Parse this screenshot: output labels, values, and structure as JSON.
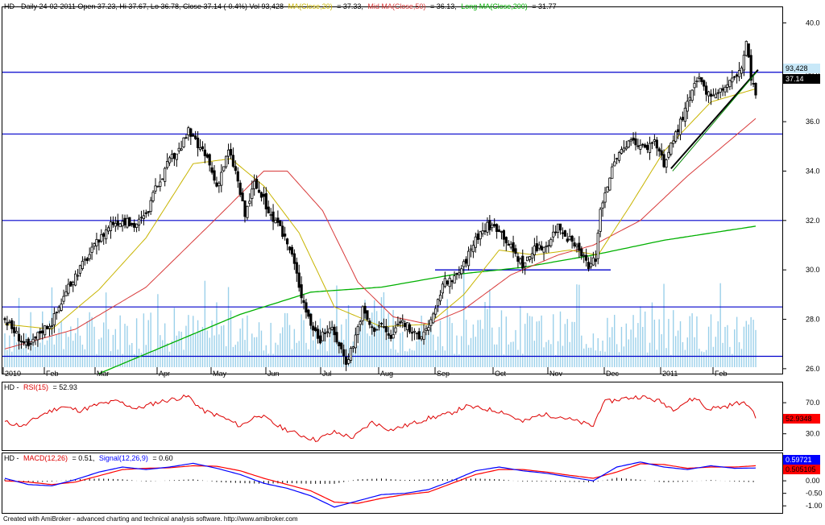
{
  "colors": {
    "price": "#000000",
    "ma20": "#c8b400",
    "ma50": "#d83a3a",
    "ma200": "#00b000",
    "volume": "#9bd0ea",
    "hline": "#0000cc",
    "trend": "#000000",
    "trend_green": "#008800",
    "rsi": "#dd0000",
    "macd": "#0000ff",
    "signal": "#ff0000",
    "hist": "#000000"
  },
  "header": {
    "symbol_info": "HD - Daily 24-02-2011 Open 37.23, Hi 37.67, Lo 36.78, Close 37.14 (-0.4%) Vol 93,428",
    "ma20_label": "MA(Close,20)",
    "ma20_value": "= 37.33,",
    "ma50_label": "Mid MA(Close,50)",
    "ma50_value": "= 36.13,",
    "ma200_label": "Long MA(Close,200)",
    "ma200_value": "= 31.77"
  },
  "rsi_header": {
    "prefix": "HD -",
    "label": "RSI(15)",
    "value": "= 52.93"
  },
  "macd_header": {
    "prefix": "HD -",
    "macd_label": "MACD(12,26)",
    "macd_value": "= 0.51,",
    "signal_label": "Signal(12,26,9)",
    "signal_value": "= 0.60"
  },
  "footer": "Created with AmiBroker - advanced charting and technical analysis software. http://www.amibroker.com",
  "chart_data": [
    {
      "type": "candlestick",
      "title": "HD - Daily",
      "x_ticks": [
        "2010",
        "Feb",
        "Mar",
        "Apr",
        "May",
        "Jun",
        "Jul",
        "Aug",
        "Sep",
        "Oct",
        "Nov",
        "Dec",
        "2011",
        "Feb"
      ],
      "y_ticks": [
        "40.0",
        "38.0",
        "36.0",
        "34.0",
        "32.0",
        "30.0",
        "28.0",
        "26.0"
      ],
      "ylim": [
        25.8,
        40.6
      ],
      "last_volume_label": "93,428",
      "last_close_label": "37.14",
      "horizontal_lines": [
        38.0,
        35.5,
        32.0,
        28.5,
        26.5
      ],
      "support_segment": {
        "y": 30.0,
        "from": "Sep",
        "to": "Nov"
      },
      "close_keypoints": [
        [
          0,
          28.0
        ],
        [
          5,
          27.4
        ],
        [
          10,
          26.8
        ],
        [
          15,
          27.5
        ],
        [
          20,
          27.9
        ],
        [
          25,
          28.9
        ],
        [
          30,
          29.8
        ],
        [
          35,
          30.5
        ],
        [
          40,
          31.2
        ],
        [
          45,
          31.9
        ],
        [
          50,
          32.0
        ],
        [
          55,
          31.8
        ],
        [
          60,
          32.2
        ],
        [
          65,
          33.5
        ],
        [
          70,
          34.4
        ],
        [
          75,
          35.0
        ],
        [
          78,
          35.6
        ],
        [
          82,
          35.0
        ],
        [
          86,
          34.5
        ],
        [
          90,
          33.4
        ],
        [
          95,
          34.8
        ],
        [
          98,
          34.0
        ],
        [
          102,
          32.2
        ],
        [
          106,
          33.5
        ],
        [
          110,
          32.8
        ],
        [
          114,
          32.0
        ],
        [
          118,
          31.5
        ],
        [
          122,
          30.6
        ],
        [
          126,
          29.0
        ],
        [
          130,
          27.8
        ],
        [
          134,
          27.2
        ],
        [
          138,
          27.7
        ],
        [
          142,
          27.0
        ],
        [
          145,
          26.3
        ],
        [
          148,
          27.0
        ],
        [
          152,
          28.4
        ],
        [
          156,
          27.6
        ],
        [
          160,
          27.8
        ],
        [
          164,
          27.2
        ],
        [
          168,
          28.0
        ],
        [
          172,
          27.6
        ],
        [
          176,
          27.2
        ],
        [
          180,
          27.8
        ],
        [
          183,
          28.3
        ],
        [
          186,
          29.5
        ],
        [
          190,
          29.5
        ],
        [
          195,
          30.2
        ],
        [
          200,
          31.3
        ],
        [
          205,
          31.8
        ],
        [
          210,
          31.7
        ],
        [
          215,
          30.9
        ],
        [
          220,
          30.2
        ],
        [
          225,
          30.8
        ],
        [
          230,
          31.0
        ],
        [
          235,
          31.8
        ],
        [
          240,
          31.2
        ],
        [
          245,
          30.6
        ],
        [
          248,
          30.1
        ],
        [
          251,
          30.5
        ],
        [
          253,
          32.5
        ],
        [
          256,
          33.5
        ],
        [
          260,
          34.6
        ],
        [
          264,
          35.0
        ],
        [
          268,
          35.2
        ],
        [
          272,
          34.9
        ],
        [
          276,
          35.3
        ],
        [
          280,
          34.2
        ],
        [
          284,
          35.3
        ],
        [
          288,
          36.2
        ],
        [
          292,
          37.2
        ],
        [
          295,
          37.8
        ],
        [
          298,
          37.0
        ],
        [
          302,
          37.2
        ],
        [
          306,
          37.4
        ],
        [
          310,
          37.8
        ],
        [
          313,
          38.2
        ],
        [
          315,
          39.2
        ],
        [
          317,
          37.8
        ],
        [
          319,
          37.1
        ]
      ],
      "ma20_keypoints": [
        [
          0,
          27.8
        ],
        [
          20,
          27.6
        ],
        [
          40,
          29.2
        ],
        [
          60,
          31.3
        ],
        [
          80,
          34.3
        ],
        [
          96,
          34.5
        ],
        [
          110,
          33.4
        ],
        [
          125,
          31.5
        ],
        [
          140,
          28.5
        ],
        [
          160,
          27.7
        ],
        [
          180,
          27.8
        ],
        [
          195,
          29.0
        ],
        [
          210,
          30.8
        ],
        [
          225,
          30.6
        ],
        [
          240,
          30.8
        ],
        [
          252,
          30.6
        ],
        [
          265,
          32.5
        ],
        [
          280,
          34.8
        ],
        [
          300,
          36.8
        ],
        [
          319,
          37.33
        ]
      ],
      "ma50_keypoints": [
        [
          0,
          26.8
        ],
        [
          30,
          27.6
        ],
        [
          60,
          29.3
        ],
        [
          90,
          32.1
        ],
        [
          110,
          34.0
        ],
        [
          120,
          34.0
        ],
        [
          135,
          32.4
        ],
        [
          150,
          29.5
        ],
        [
          165,
          28.1
        ],
        [
          180,
          27.8
        ],
        [
          195,
          28.4
        ],
        [
          215,
          29.8
        ],
        [
          235,
          30.6
        ],
        [
          250,
          31.0
        ],
        [
          270,
          32.0
        ],
        [
          290,
          33.8
        ],
        [
          310,
          35.4
        ],
        [
          319,
          36.13
        ]
      ],
      "ma200_keypoints": [
        [
          40,
          25.8
        ],
        [
          70,
          27.0
        ],
        [
          100,
          28.2
        ],
        [
          130,
          29.1
        ],
        [
          160,
          29.3
        ],
        [
          190,
          29.8
        ],
        [
          220,
          30.1
        ],
        [
          250,
          30.6
        ],
        [
          280,
          31.2
        ],
        [
          319,
          31.77
        ]
      ],
      "trend_segment": {
        "from_index": 283,
        "y1": 34.1,
        "to_index": 320,
        "y2": 38.1
      }
    },
    {
      "type": "line",
      "title": "RSI(15)",
      "y_ticks": [
        "70.0",
        "30.0"
      ],
      "ylim": [
        10,
        95
      ],
      "last_value_label": "52.9348",
      "rsi_keypoints": [
        [
          0,
          45
        ],
        [
          8,
          40
        ],
        [
          16,
          55
        ],
        [
          24,
          65
        ],
        [
          32,
          60
        ],
        [
          40,
          68
        ],
        [
          48,
          72
        ],
        [
          56,
          62
        ],
        [
          64,
          70
        ],
        [
          72,
          75
        ],
        [
          78,
          78
        ],
        [
          84,
          60
        ],
        [
          92,
          52
        ],
        [
          100,
          40
        ],
        [
          108,
          55
        ],
        [
          116,
          40
        ],
        [
          124,
          30
        ],
        [
          132,
          22
        ],
        [
          140,
          32
        ],
        [
          148,
          25
        ],
        [
          156,
          45
        ],
        [
          164,
          35
        ],
        [
          172,
          42
        ],
        [
          180,
          50
        ],
        [
          188,
          55
        ],
        [
          196,
          65
        ],
        [
          204,
          62
        ],
        [
          212,
          58
        ],
        [
          220,
          45
        ],
        [
          228,
          55
        ],
        [
          236,
          52
        ],
        [
          244,
          45
        ],
        [
          250,
          40
        ],
        [
          254,
          70
        ],
        [
          262,
          75
        ],
        [
          270,
          78
        ],
        [
          278,
          72
        ],
        [
          284,
          62
        ],
        [
          290,
          72
        ],
        [
          294,
          76
        ],
        [
          298,
          62
        ],
        [
          306,
          65
        ],
        [
          312,
          70
        ],
        [
          316,
          67
        ],
        [
          319,
          53
        ]
      ]
    },
    {
      "type": "line",
      "title": "MACD(12,26)",
      "y_ticks": [
        "0.50",
        "0.00",
        "-0.50",
        "-1.00"
      ],
      "ylim": [
        -1.25,
        1.0
      ],
      "last_value_labels": [
        "0.59721",
        "0.505105"
      ],
      "macd_keypoints": [
        [
          0,
          0.1
        ],
        [
          10,
          -0.15
        ],
        [
          20,
          -0.2
        ],
        [
          30,
          0.05
        ],
        [
          40,
          0.35
        ],
        [
          50,
          0.55
        ],
        [
          60,
          0.45
        ],
        [
          70,
          0.55
        ],
        [
          80,
          0.7
        ],
        [
          90,
          0.5
        ],
        [
          100,
          0.25
        ],
        [
          110,
          -0.1
        ],
        [
          120,
          -0.3
        ],
        [
          130,
          -0.6
        ],
        [
          140,
          -1.05
        ],
        [
          150,
          -0.8
        ],
        [
          160,
          -0.55
        ],
        [
          170,
          -0.5
        ],
        [
          180,
          -0.35
        ],
        [
          190,
          0.0
        ],
        [
          200,
          0.4
        ],
        [
          210,
          0.55
        ],
        [
          220,
          0.4
        ],
        [
          230,
          0.3
        ],
        [
          240,
          0.15
        ],
        [
          250,
          0.0
        ],
        [
          260,
          0.55
        ],
        [
          270,
          0.75
        ],
        [
          280,
          0.55
        ],
        [
          290,
          0.45
        ],
        [
          300,
          0.6
        ],
        [
          310,
          0.5
        ],
        [
          319,
          0.51
        ]
      ],
      "signal_keypoints": [
        [
          0,
          0.0
        ],
        [
          10,
          -0.05
        ],
        [
          20,
          -0.15
        ],
        [
          30,
          -0.05
        ],
        [
          40,
          0.2
        ],
        [
          50,
          0.45
        ],
        [
          60,
          0.5
        ],
        [
          70,
          0.52
        ],
        [
          80,
          0.6
        ],
        [
          90,
          0.58
        ],
        [
          100,
          0.4
        ],
        [
          110,
          0.1
        ],
        [
          120,
          -0.15
        ],
        [
          130,
          -0.4
        ],
        [
          140,
          -0.85
        ],
        [
          150,
          -0.9
        ],
        [
          160,
          -0.7
        ],
        [
          170,
          -0.55
        ],
        [
          180,
          -0.45
        ],
        [
          190,
          -0.1
        ],
        [
          200,
          0.25
        ],
        [
          210,
          0.45
        ],
        [
          220,
          0.45
        ],
        [
          230,
          0.35
        ],
        [
          240,
          0.22
        ],
        [
          250,
          0.1
        ],
        [
          260,
          0.35
        ],
        [
          270,
          0.68
        ],
        [
          280,
          0.65
        ],
        [
          290,
          0.5
        ],
        [
          300,
          0.55
        ],
        [
          310,
          0.55
        ],
        [
          319,
          0.6
        ]
      ]
    }
  ]
}
